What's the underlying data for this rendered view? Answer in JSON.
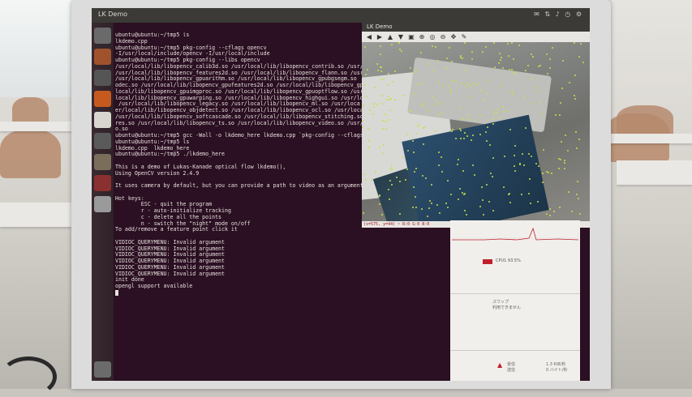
{
  "top_bar": {
    "title": "LK Demo",
    "indicators": "✉ ⇅ ♪ ◷ ⚙"
  },
  "terminal": {
    "lines": [
      "ubuntu@ubuntu:~/tmp5 ls",
      "lkdemo.cpp",
      "ubuntu@ubuntu:~/tmp5 pkg-config --cflags opencv",
      "-I/usr/local/include/opencv -I/usr/local/include",
      "ubuntu@ubuntu:~/tmp5 pkg-config --libs opencv",
      "/usr/local/lib/libopencv_calib3d.so /usr/local/lib/libopencv_contrib.so /usr/",
      "/usr/local/lib/libopencv_features2d.so /usr/local/lib/libopencv_flann.so /usr/",
      "/usr/local/lib/libopencv_gpuarithm.so /usr/local/lib/libopencv_gpubgsegm.so",
      "odec.so /usr/local/lib/libopencv_gpufeatures2d.so /usr/local/lib/libopencv_gp",
      "local/lib/libopencv_gpuimgproc.so /usr/local/lib/libopencv_gpuoptflow.so /usr/",
      "local/lib/libopencv_gpuwarping.so /usr/local/lib/libopencv_highgui.so /usr/loc",
      " /usr/local/lib/libopencv_legacy.so /usr/local/lib/libopencv_ml.so /usr/loca",
      "er/local/lib/libopencv_objdetect.so /usr/local/lib/libopencv_ocl.so /usr/loca",
      "/usr/local/lib/libopencv_softcascade.so /usr/local/lib/libopencv_stitching.so /",
      "res.so /usr/local/lib/libopencv_ts.so /usr/local/lib/libopencv_video.so /usr/",
      "o.so",
      "ubuntu@ubuntu:~/tmp5 gcc -Wall -o lkdemo_here lkdemo.cpp `pkg-config --cflags",
      "ubuntu@ubuntu:~/tmp5 ls",
      "lkdemo.cpp  lkdemo_here",
      "ubuntu@ubuntu:~/tmp5 ./lkdemo_here",
      "",
      "This is a demo of Lukas-Kanade optical flow lkdemo(),",
      "Using OpenCV version 2.4.9",
      "",
      "It uses camera by default, but you can provide a path to video as an argument",
      "",
      "Hot keys:",
      "        ESC - quit the program",
      "        r - auto-initialize tracking",
      "        c - delete all the points",
      "        n - switch the \"night\" mode on/off",
      "To add/remove a feature point click it",
      "",
      "VIDIOC_QUERYMENU: Invalid argument",
      "VIDIOC_QUERYMENU: Invalid argument",
      "VIDIOC_QUERYMENU: Invalid argument",
      "VIDIOC_QUERYMENU: Invalid argument",
      "VIDIOC_QUERYMENU: Invalid argument",
      "VIDIOC_QUERYMENU: Invalid argument",
      "init done",
      "opengl support available"
    ]
  },
  "lk_window": {
    "title": "LK Demo",
    "toolbar_icons": [
      "arrow-left-icon",
      "arrow-right-icon",
      "arrow-up-icon",
      "arrow-down-icon",
      "save-icon",
      "zoom-in-icon",
      "zoom-icon",
      "zoom-out-icon",
      "pan-icon",
      "settings-icon"
    ],
    "status": "(x=575, y=44) ~ R:0 G:0 B:0"
  },
  "graph_panel": {
    "legend": "CPU1 93.5%",
    "label_1": "スワップ",
    "label_2": "利用できません",
    "label_3": "受信",
    "label_4": "送信",
    "label_5": "1.3 KiB/秒",
    "label_6": "0 バイト/秒"
  }
}
